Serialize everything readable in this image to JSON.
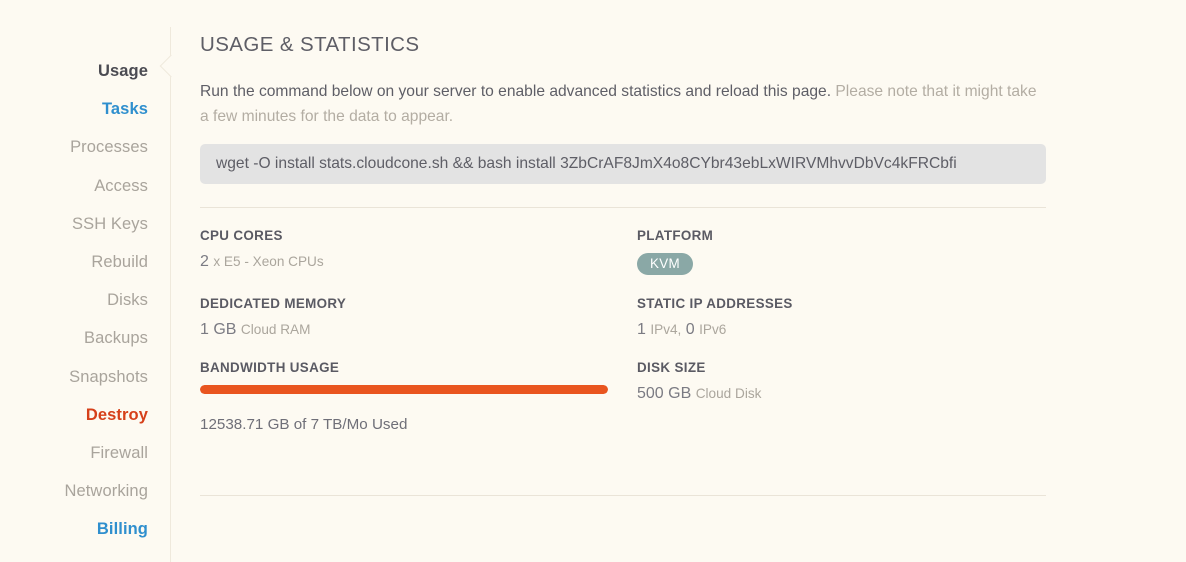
{
  "sidebar": {
    "items": [
      {
        "label": "Usage",
        "state": "active"
      },
      {
        "label": "Tasks",
        "state": "link"
      },
      {
        "label": "Processes",
        "state": "normal"
      },
      {
        "label": "Access",
        "state": "normal"
      },
      {
        "label": "SSH Keys",
        "state": "normal"
      },
      {
        "label": "Rebuild",
        "state": "normal"
      },
      {
        "label": "Disks",
        "state": "normal"
      },
      {
        "label": "Backups",
        "state": "normal"
      },
      {
        "label": "Snapshots",
        "state": "normal"
      },
      {
        "label": "Destroy",
        "state": "danger"
      },
      {
        "label": "Firewall",
        "state": "normal"
      },
      {
        "label": "Networking",
        "state": "normal"
      },
      {
        "label": "Billing",
        "state": "link"
      }
    ]
  },
  "main": {
    "title": "USAGE & STATISTICS",
    "intro_primary": "Run the command below on your server to enable advanced statistics and reload this page.",
    "intro_muted": "Please note that it might take a few minutes for the data to appear.",
    "command": "wget -O install stats.cloudcone.sh && bash install 3ZbCrAF8JmX4o8CYbr43ebLxWIRVMhvvDbVc4kFRCbfi",
    "stats": {
      "cpu_cores": {
        "label": "CPU CORES",
        "value": "2",
        "unit": "x E5 - Xeon CPUs"
      },
      "platform": {
        "label": "PLATFORM",
        "badge": "KVM",
        "badge_color": "#8aa8a6"
      },
      "dedicated_memory": {
        "label": "DEDICATED MEMORY",
        "value": "1 GB",
        "unit": "Cloud RAM"
      },
      "static_ip": {
        "label": "STATIC IP ADDRESSES",
        "ipv4_count": "1",
        "ipv4_unit": "IPv4,",
        "ipv6_count": "0",
        "ipv6_unit": "IPv6"
      },
      "bandwidth": {
        "label": "BANDWIDTH USAGE",
        "percent": 100,
        "bar_color": "#e9551f",
        "caption": "12538.71 GB of 7 TB/Mo Used"
      },
      "disk_size": {
        "label": "DISK SIZE",
        "value": "500 GB",
        "unit": "Cloud Disk"
      }
    }
  }
}
